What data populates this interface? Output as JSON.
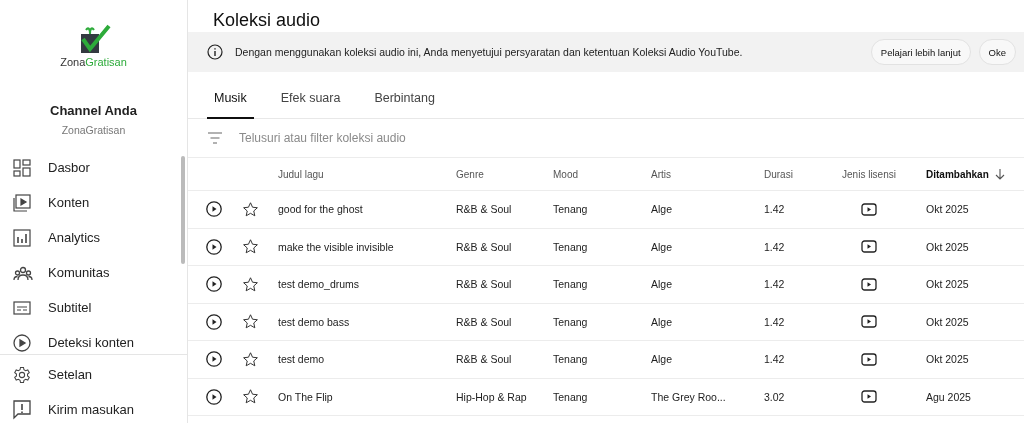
{
  "sidebar": {
    "logo_text": [
      "Zona",
      "Gratisan"
    ],
    "channel_title": "Channel Anda",
    "channel_name": "ZonaGratisan",
    "items": [
      {
        "label": "Dasbor"
      },
      {
        "label": "Konten"
      },
      {
        "label": "Analytics"
      },
      {
        "label": "Komunitas"
      },
      {
        "label": "Subtitel"
      },
      {
        "label": "Deteksi konten"
      }
    ],
    "bottom_items": [
      {
        "label": "Setelan"
      },
      {
        "label": "Kirim masukan"
      }
    ]
  },
  "page_title": "Koleksi audio",
  "banner": {
    "text": "Dengan menggunakan koleksi audio ini, Anda menyetujui persyaratan dan ketentuan Koleksi Audio YouTube.",
    "buttons": [
      "Pelajari lebih lanjut",
      "Oke"
    ]
  },
  "tabs": [
    {
      "label": "Musik",
      "selected": true
    },
    {
      "label": "Efek suara",
      "selected": false
    },
    {
      "label": "Berbintang",
      "selected": false
    }
  ],
  "search": {
    "placeholder": "Telusuri atau filter koleksi audio"
  },
  "table": {
    "columns": [
      {
        "label": "Judul lagu",
        "sorted": false
      },
      {
        "label": "Genre",
        "sorted": false
      },
      {
        "label": "Mood",
        "sorted": false
      },
      {
        "label": "Artis",
        "sorted": false
      },
      {
        "label": "Durasi",
        "sorted": false
      },
      {
        "label": "Jenis lisensi",
        "sorted": false
      },
      {
        "label": "Ditambahkan",
        "sorted": true
      }
    ],
    "rows": [
      {
        "title": "good for the ghost",
        "genre": "R&B & Soul",
        "mood": "Tenang",
        "artist": "Alge",
        "duration": "1.42",
        "added": "Okt 2025"
      },
      {
        "title": "make the visible invisible",
        "genre": "R&B & Soul",
        "mood": "Tenang",
        "artist": "Alge",
        "duration": "1.42",
        "added": "Okt 2025"
      },
      {
        "title": "test demo_drums",
        "genre": "R&B & Soul",
        "mood": "Tenang",
        "artist": "Alge",
        "duration": "1.42",
        "added": "Okt 2025"
      },
      {
        "title": "test demo bass",
        "genre": "R&B & Soul",
        "mood": "Tenang",
        "artist": "Alge",
        "duration": "1.42",
        "added": "Okt 2025"
      },
      {
        "title": "test demo",
        "genre": "R&B & Soul",
        "mood": "Tenang",
        "artist": "Alge",
        "duration": "1.42",
        "added": "Okt 2025"
      },
      {
        "title": "On The Flip",
        "genre": "Hip-Hop & Rap",
        "mood": "Tenang",
        "artist": "The Grey Roo...",
        "duration": "3.02",
        "added": "Agu 2025"
      }
    ]
  }
}
